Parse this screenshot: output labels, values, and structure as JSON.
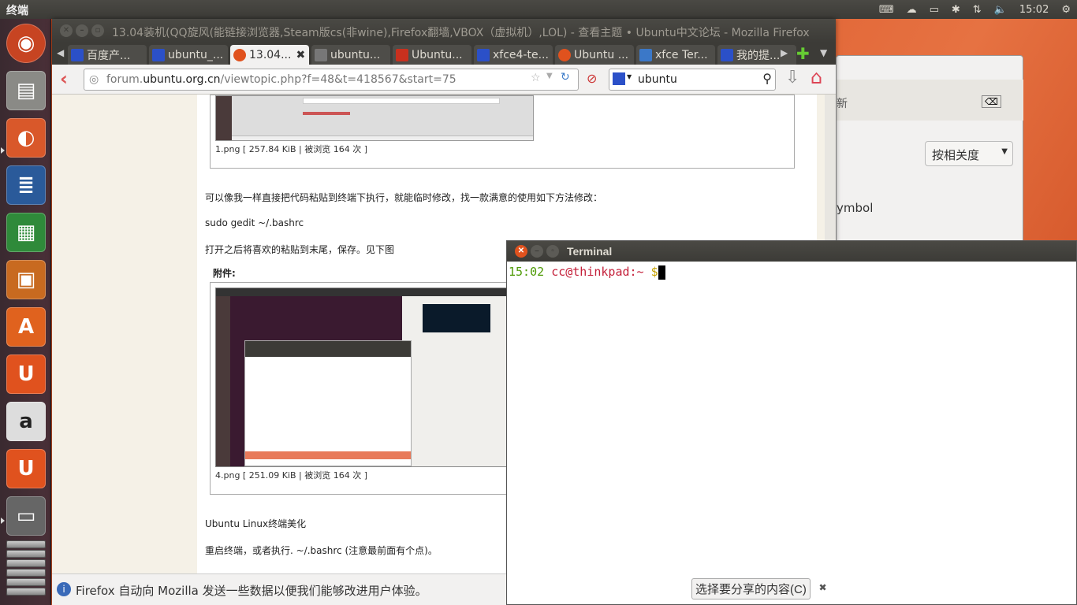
{
  "topbar": {
    "title": "终端",
    "clock": "15:02"
  },
  "tray_icons": [
    "keyboard-icon",
    "cloud-icon",
    "battery-icon",
    "bluetooth-icon",
    "network-icon",
    "volume-icon"
  ],
  "firefox": {
    "title": "13.04装机(QQ旋风(能链接浏览器,Steam版cs(非wine),Firefox翻墙,VBOX（虚拟机）,LOL) - 查看主题 • Ubuntu中文论坛 - Mozilla Firefox",
    "tabs": [
      {
        "label": "百度产..."
      },
      {
        "label": "ubuntu_..."
      },
      {
        "label": "13.04..."
      },
      {
        "label": "ubuntu..."
      },
      {
        "label": "Ubuntu..."
      },
      {
        "label": "xfce4-te..."
      },
      {
        "label": "Ubuntu ..."
      },
      {
        "label": "xfce Ter..."
      },
      {
        "label": "我的提..."
      }
    ],
    "url_prefix": "forum.",
    "url_host": "ubuntu.org.cn",
    "url_path": "/viewtopic.php?f=48&t=418567&start=75",
    "search_value": "ubuntu",
    "notification": "Firefox 自动向 Mozilla 发送一些数据以便我们能够改进用户体验。",
    "share_button": "选择要分享的内容(C)"
  },
  "post": {
    "cap1": "1.png [ 257.84 KiB | 被浏览 164 次 ]",
    "p1": "可以像我一样直接把代码粘贴到终端下执行，就能临时修改，找一款满意的使用如下方法修改：",
    "p2": "sudo gedit ~/.bashrc",
    "p3": "打开之后将喜欢的粘贴到末尾，保存。见下图",
    "attach": "附件:",
    "cap2": "4.png [ 251.09 KiB | 被浏览 164 次 ]",
    "p4": "Ubuntu Linux终端美化",
    "p5": "重启终端，或者执行. ~/.bashrc (注意最前面有个点)。"
  },
  "bgwin": {
    "search_hint": "新",
    "sort_label": "按相关度",
    "partial_text": "ymbol"
  },
  "terminal": {
    "title": "Terminal",
    "time": "15:02",
    "user": "cc@thinkpad:~",
    "prompt": "$"
  }
}
